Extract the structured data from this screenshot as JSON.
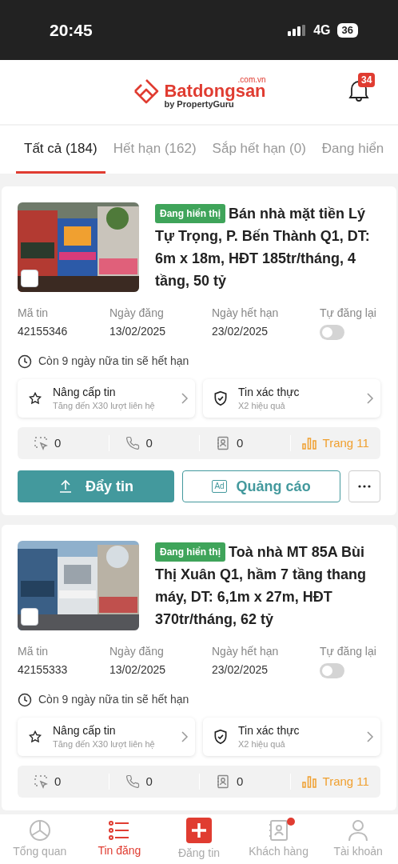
{
  "status_bar": {
    "time": "20:45",
    "network": "4G",
    "battery": "36"
  },
  "header": {
    "logo_name": "Batdongsan",
    "logo_domain": ".com.vn",
    "logo_tagline": "by PropertyGuru",
    "notification_count": "34"
  },
  "tabs": [
    {
      "label": "Tất cả (184)",
      "selected": true
    },
    {
      "label": "Hết hạn (162)",
      "selected": false
    },
    {
      "label": "Sắp hết hạn (0)",
      "selected": false
    },
    {
      "label": "Đang hiển",
      "selected": false
    }
  ],
  "listings": [
    {
      "kind": "picture",
      "photo_checked": false,
      "status_badge": "Đang hiển thị",
      "title": "Bán nhà mặt tiền Lý Tự Trọng, P. Bến Thành Q1, DT: 6m x 18m, HĐT 185tr/tháng, 4 tầng, 50 tỷ",
      "fields": [
        {
          "label": "Mã tin",
          "value": "42155346"
        },
        {
          "label": "Ngày đăng",
          "value": "13/02/2025"
        },
        {
          "label": "Ngày hết hạn",
          "value": "23/02/2025"
        }
      ],
      "auto_repost": {
        "label": "Tự đăng lại",
        "on": false
      },
      "expiry_note": "Còn 9 ngày nữa tin sẽ hết hạn",
      "upgrades": [
        {
          "kind": "star",
          "title": "Nâng cấp tin",
          "subtitle": "Tăng đến X30 lượt liên hệ"
        },
        {
          "kind": "shield",
          "title": "Tin xác thực",
          "subtitle": "X2 hiệu quả"
        }
      ],
      "stats": [
        {
          "kind": "clicks",
          "value": "0"
        },
        {
          "kind": "calls",
          "value": "0"
        },
        {
          "kind": "contacts",
          "value": "0"
        },
        {
          "kind": "rank",
          "value": "Trang 11"
        }
      ],
      "actions": {
        "push": "Đẩy tin",
        "ads": "Quảng cáo",
        "ad_icon": "Ad"
      }
    },
    {
      "kind": "picture",
      "photo_checked": false,
      "status_badge": "Đang hiển thị",
      "title": "Toà nhà MT 85A Bùi Thị Xuân Q1, hầm 7 tầng thang máy, DT: 6,1m x 27m, HĐT 370tr/tháng, 62 tỷ",
      "fields": [
        {
          "label": "Mã tin",
          "value": "42155333"
        },
        {
          "label": "Ngày đăng",
          "value": "13/02/2025"
        },
        {
          "label": "Ngày hết hạn",
          "value": "23/02/2025"
        }
      ],
      "auto_repost": {
        "label": "Tự đăng lại",
        "on": false
      },
      "expiry_note": "Còn 9 ngày nữa tin sẽ hết hạn",
      "upgrades": [
        {
          "kind": "star",
          "title": "Nâng cấp tin",
          "subtitle": "Tăng đến X30 lượt liên hệ"
        },
        {
          "kind": "shield",
          "title": "Tin xác thực",
          "subtitle": "X2 hiệu quả"
        }
      ],
      "stats": [
        {
          "kind": "clicks",
          "value": "0"
        },
        {
          "kind": "calls",
          "value": "0"
        },
        {
          "kind": "contacts",
          "value": "0"
        },
        {
          "kind": "rank",
          "value": "Trang 11"
        }
      ]
    }
  ],
  "bottom_nav": [
    {
      "kind": "overview",
      "label": "Tổng quan",
      "selected": false,
      "dot": false
    },
    {
      "kind": "list",
      "label": "Tin đăng",
      "selected": true,
      "dot": false
    },
    {
      "kind": "post",
      "label": "Đăng tin",
      "selected": false,
      "dot": false
    },
    {
      "kind": "customers",
      "label": "Khách hàng",
      "selected": false,
      "dot": true
    },
    {
      "kind": "account",
      "label": "Tài khoản",
      "selected": false,
      "dot": false
    }
  ]
}
